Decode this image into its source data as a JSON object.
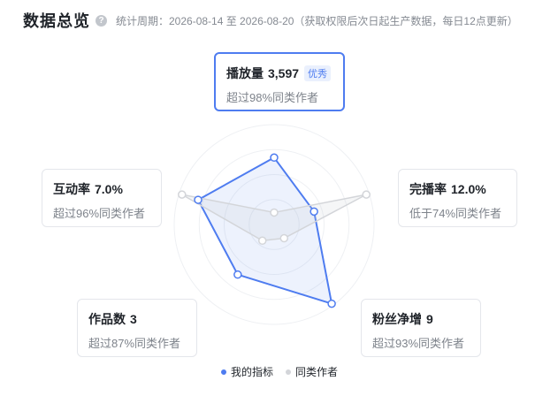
{
  "header": {
    "title": "数据总览",
    "help_icon": "?",
    "period": "统计周期：2026-08-14 至 2026-08-20（获取权限后次日起生产数据，每日12点更新）"
  },
  "metrics": {
    "play": {
      "label": "播放量",
      "value": "3,597",
      "badge": "优秀",
      "desc": "超过98%同类作者"
    },
    "complete": {
      "label": "完播率",
      "value": "12.0%",
      "desc": "低于74%同类作者"
    },
    "fans": {
      "label": "粉丝净增",
      "value": "9",
      "desc": "超过93%同类作者"
    },
    "works": {
      "label": "作品数",
      "value": "3",
      "desc": "超过87%同类作者"
    },
    "interact": {
      "label": "互动率",
      "value": "7.0%",
      "desc": "超过96%同类作者"
    }
  },
  "chart_data": {
    "type": "radar",
    "axes": [
      "播放量",
      "完播率",
      "粉丝净增",
      "作品数",
      "互动率"
    ],
    "range": [
      0,
      1
    ],
    "series": [
      {
        "name": "我的指标",
        "color": "#4e7cf0",
        "values": [
          0.67,
          0.42,
          0.98,
          0.62,
          0.8
        ]
      },
      {
        "name": "同类作者",
        "color": "#d3d5d9",
        "values": [
          0.12,
          0.97,
          0.17,
          0.2,
          0.97
        ]
      }
    ]
  },
  "legend": {
    "mine": "我的指标",
    "peer": "同类作者"
  }
}
